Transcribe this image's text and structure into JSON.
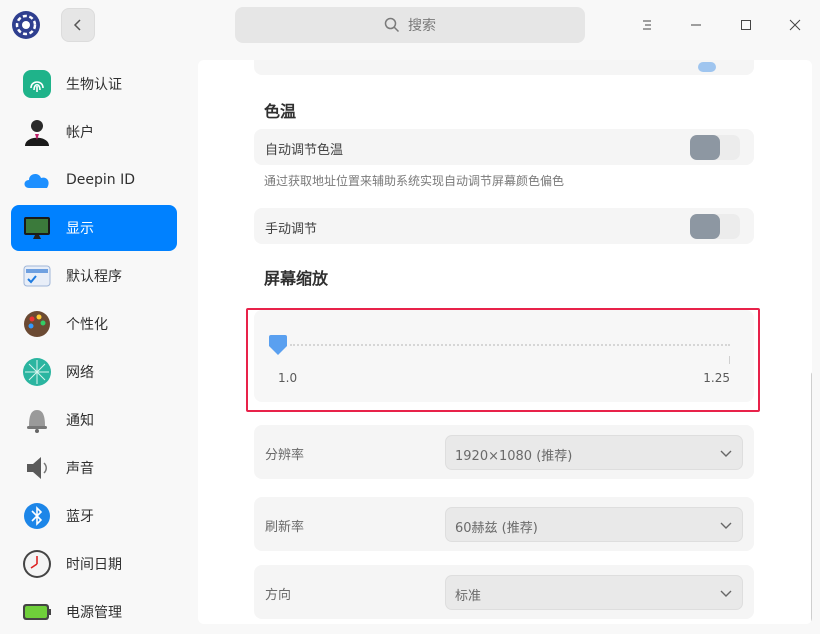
{
  "titlebar": {
    "search_placeholder": "搜索",
    "menu_label": "☰",
    "minimize_label": "—",
    "maximize_label": "☐",
    "close_label": "✕"
  },
  "sidebar": {
    "items": [
      {
        "label": "生物认证",
        "icon": "fingerprint-icon"
      },
      {
        "label": "帐户",
        "icon": "account-icon"
      },
      {
        "label": "Deepin ID",
        "icon": "cloud-icon"
      },
      {
        "label": "显示",
        "icon": "display-icon",
        "active": true
      },
      {
        "label": "默认程序",
        "icon": "default-apps-icon"
      },
      {
        "label": "个性化",
        "icon": "palette-icon"
      },
      {
        "label": "网络",
        "icon": "network-icon"
      },
      {
        "label": "通知",
        "icon": "bell-icon"
      },
      {
        "label": "声音",
        "icon": "speaker-icon"
      },
      {
        "label": "蓝牙",
        "icon": "bluetooth-icon"
      },
      {
        "label": "时间日期",
        "icon": "clock-icon"
      },
      {
        "label": "电源管理",
        "icon": "battery-icon"
      }
    ]
  },
  "main": {
    "color_temp": {
      "title": "色温",
      "auto_label": "自动调节色温",
      "auto_on": false,
      "hint": "通过获取地址位置来辅助系统实现自动调节屏幕颜色偏色",
      "manual_label": "手动调节",
      "manual_on": false
    },
    "scale": {
      "title": "屏幕缩放",
      "min_label": "1.0",
      "max_label": "1.25",
      "value": 1.0
    },
    "resolution": {
      "label": "分辨率",
      "value": "1920×1080 (推荐)"
    },
    "refresh": {
      "label": "刷新率",
      "value": "60赫兹 (推荐)"
    },
    "orientation": {
      "label": "方向",
      "value": "标准"
    }
  },
  "colors": {
    "accent": "#0081ff",
    "highlight": "#e8224a",
    "toggle_knob": "#8d97a2"
  }
}
